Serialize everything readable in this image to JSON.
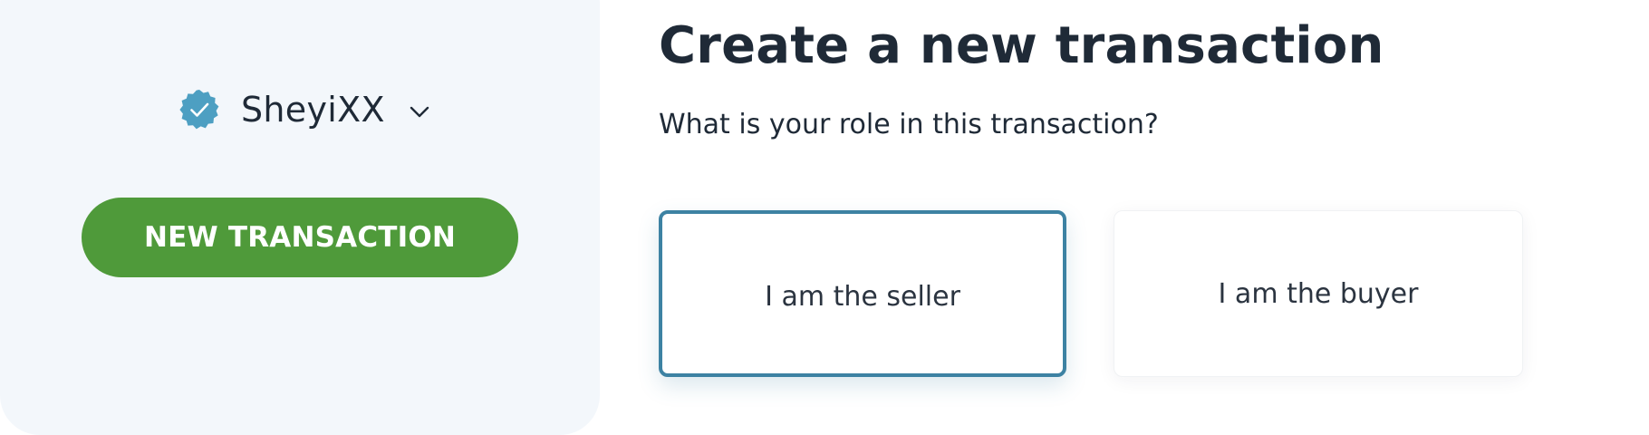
{
  "sidebar": {
    "username": "SheyiXX",
    "new_transaction_label": "NEW TRANSACTION",
    "verified_color": "#4d9fc2",
    "button_color": "#4f9a3a"
  },
  "main": {
    "title": "Create a new transaction",
    "question": "What is your role in this transaction?",
    "roles": [
      {
        "label": "I am the seller",
        "selected": true
      },
      {
        "label": "I am the buyer",
        "selected": false
      }
    ],
    "selected_border_color": "#3d82a3"
  }
}
